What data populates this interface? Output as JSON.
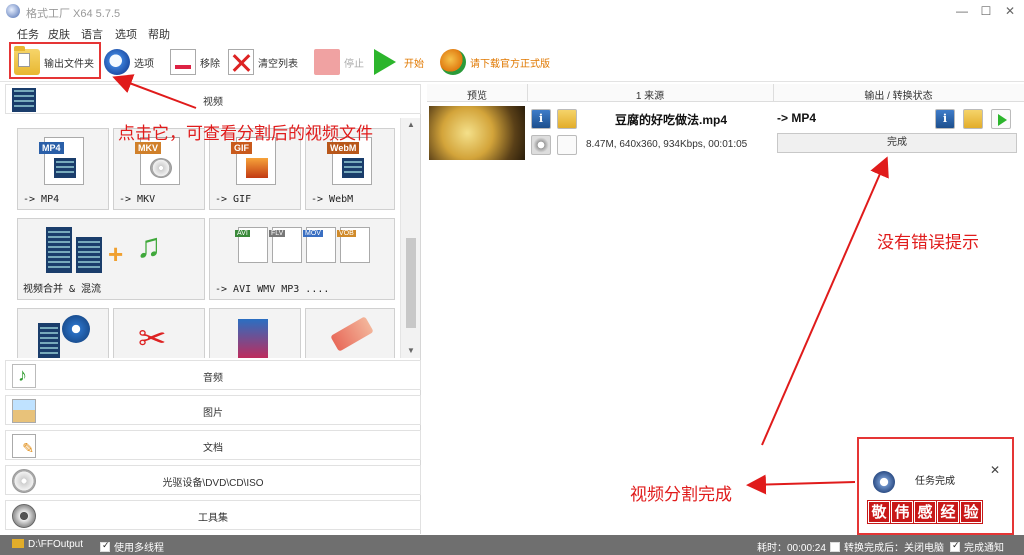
{
  "window": {
    "title": "格式工厂 X64 5.7.5",
    "minimize": "—",
    "maximize": "☐",
    "close": "✕"
  },
  "menu": {
    "items": [
      "任务",
      "皮肤",
      "语言",
      "选项",
      "帮助"
    ]
  },
  "toolbar": {
    "output_folder": "输出文件夹",
    "options": "选项",
    "remove": "移除",
    "clear_list": "清空列表",
    "stop": "停止",
    "start": "开始",
    "download_official": "请下载官方正式版"
  },
  "categories": {
    "video": "视频",
    "audio": "音频",
    "picture": "图片",
    "document": "文档",
    "disc": "光驱设备\\DVD\\CD\\ISO",
    "tools": "工具集"
  },
  "video_tiles": [
    {
      "label": "-> MP4",
      "badge": "MP4"
    },
    {
      "label": "-> MKV",
      "badge": "MKV"
    },
    {
      "label": "-> GIF",
      "badge": "GIF"
    },
    {
      "label": "-> WebM",
      "badge": "WebM"
    },
    {
      "label": "视频合并 & 混流"
    },
    {
      "label": "-> AVI WMV MP3 ...."
    }
  ],
  "task_table": {
    "headers": {
      "preview": "预览",
      "source": "1 来源",
      "output": "输出 / 转换状态"
    },
    "row": {
      "filename": "豆腐的好吃做法.mp4",
      "info": "8.47M, 640x360, 934Kbps, 00:01:05",
      "output_format": "-> MP4",
      "status": "完成"
    }
  },
  "annotations": {
    "click_hint": "点击它，可查看分割后的视频文件",
    "no_error": "没有错误提示",
    "split_done": "视频分割完成"
  },
  "notification": {
    "title": "任务完成"
  },
  "watermark": {
    "chars": [
      "敬",
      "伟",
      "感",
      "经",
      "验"
    ]
  },
  "footer": {
    "output_path": "D:\\FFOutput",
    "multithread": "使用多线程",
    "elapsed": "耗时：00:00:24",
    "after_convert": "转换完成后：关闭电脑",
    "completion_notify": "完成通知"
  },
  "colors": {
    "annotation_red": "#e01b1b",
    "highlight_box": "#e53535",
    "footer_bg": "#6f6f6f",
    "start_green": "#2cb52c"
  }
}
